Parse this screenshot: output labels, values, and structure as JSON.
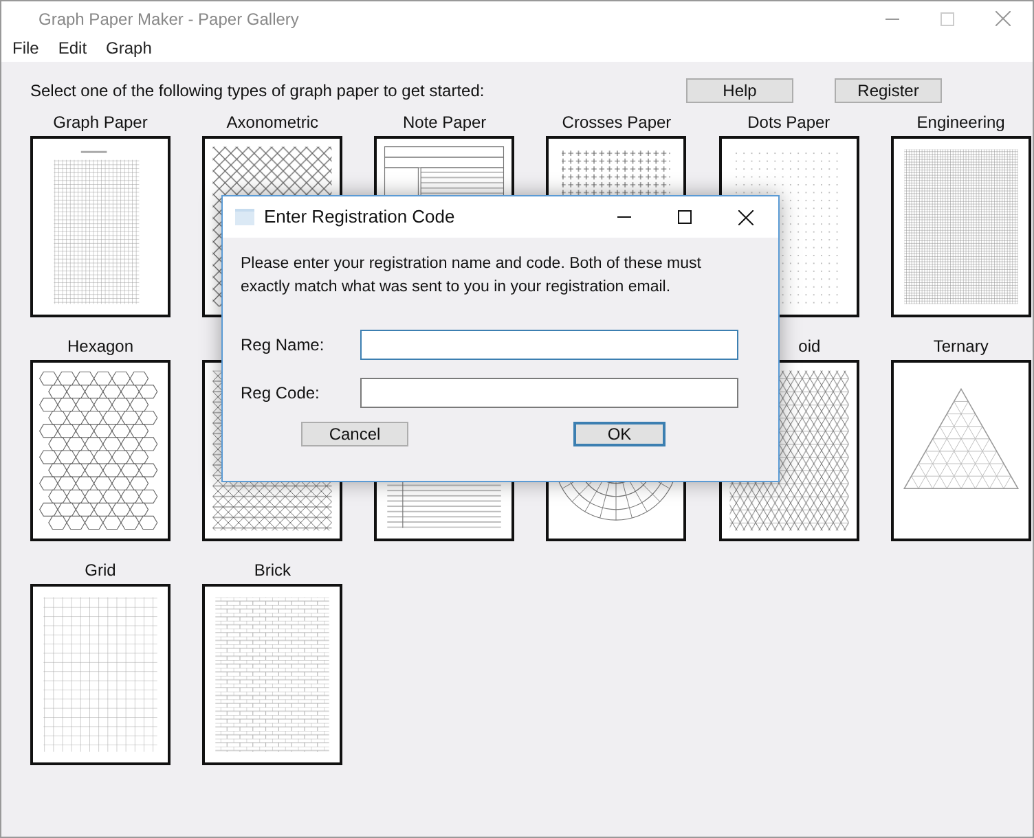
{
  "window": {
    "title": "Graph Paper Maker - Paper Gallery"
  },
  "menu": [
    "File",
    "Edit",
    "Graph"
  ],
  "prompt": "Select one of the following types of graph paper to get started:",
  "buttons": [
    "Help",
    "Register"
  ],
  "papers": [
    {
      "label": "Graph Paper",
      "kind": "graph"
    },
    {
      "label": "Axonometric",
      "kind": "axonometric"
    },
    {
      "label": "Note Paper",
      "kind": "note"
    },
    {
      "label": "Crosses Paper",
      "kind": "crosses"
    },
    {
      "label": "Dots Paper",
      "kind": "dots"
    },
    {
      "label": "Engineering",
      "kind": "engineering"
    },
    {
      "label": "Hexagon",
      "kind": "hexagon"
    },
    {
      "kind": "triangles"
    },
    {
      "kind": "lined"
    },
    {
      "kind": "polar"
    },
    {
      "label": "oid",
      "label_cut": true,
      "kind": "diamond"
    },
    {
      "label": "Ternary",
      "kind": "ternary"
    },
    {
      "label": "Grid",
      "kind": "grid"
    },
    {
      "label": "Brick",
      "kind": "brick"
    }
  ],
  "dialog": {
    "title": "Enter Registration Code",
    "message": "Please enter your registration name and code. Both of these must exactly match what was sent to you in your registration email.",
    "fields": [
      {
        "label": "Reg Name:",
        "focused": true
      },
      {
        "label": "Reg Code:",
        "focused": false
      }
    ],
    "buttons": [
      {
        "label": "Cancel",
        "default": false
      },
      {
        "label": "OK",
        "default": true
      }
    ]
  }
}
